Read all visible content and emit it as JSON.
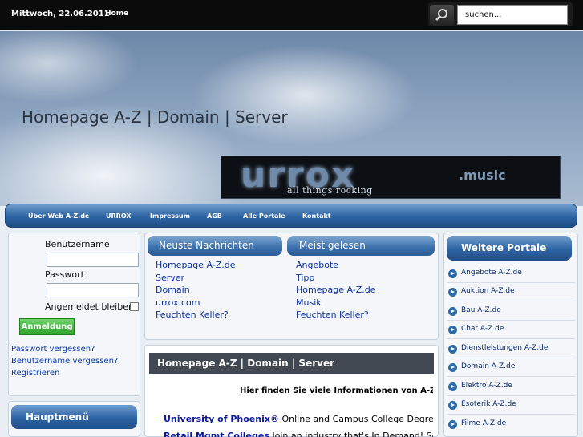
{
  "topbar": {
    "date": "Mittwoch, 22.06.2011",
    "home_label": "Home",
    "search_value": "suchen..."
  },
  "header": {
    "title": "Homepage A-Z | Domain | Server",
    "banner": {
      "logo": "urrox",
      "logo_sub": ".music",
      "tagline": "all things rocking"
    }
  },
  "nav": {
    "items": [
      "Über Web A-Z.de",
      "URROX",
      "Impressum",
      "AGB",
      "Alle Portale",
      "Kontakt"
    ]
  },
  "login": {
    "username_label": "Benutzername",
    "password_label": "Passwort",
    "remember_label": "Angemeldet bleiben",
    "submit_label": "Anmeldung",
    "links": [
      "Passwort vergessen?",
      "Benutzername vergessen?",
      "Registrieren"
    ]
  },
  "hauptmenu": {
    "title": "Hauptmenü"
  },
  "news": {
    "tab_new": "Neuste Nachrichten",
    "tab_popular": "Meist gelesen",
    "new_items": [
      "Homepage A-Z.de",
      "Server",
      "Domain",
      "urrox.com",
      "Feuchten Keller?"
    ],
    "popular_items": [
      "Angebote",
      "Tipp",
      "Homepage A-Z.de",
      "Musik",
      "Feuchten Keller?"
    ]
  },
  "content": {
    "heading": "Homepage A-Z | Domain | Server",
    "intro": "Hier finden Sie viele Informationen von A-Z rund",
    "ads": [
      {
        "link": "University of Phoenix®",
        "text": " Online and Campus College Degrees. G"
      },
      {
        "link": "Retail Mgmt Colleges",
        "text": " Join an Industry that's In Demand! Search"
      }
    ]
  },
  "portals": {
    "title": "Weitere Portale",
    "items": [
      "Angebote A-Z.de",
      "Auktion A-Z.de",
      "Bau A-Z.de",
      "Chat A-Z.de",
      "Dienstleistungen A-Z.de",
      "Domain A-Z.de",
      "Elektro A-Z.de",
      "Esoterik A-Z.de",
      "Filme A-Z.de"
    ]
  }
}
